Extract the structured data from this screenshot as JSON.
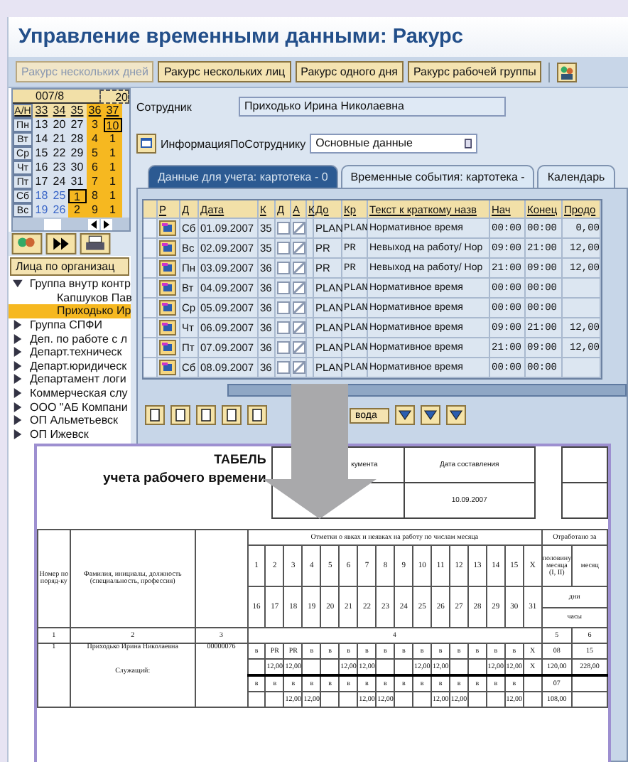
{
  "window": {
    "title": "Управление временными данными: Ракурс"
  },
  "toolbar": [
    {
      "label": "Ракурс нескольких дней",
      "disabled": true
    },
    {
      "label": "Ракурс нескольких лиц",
      "disabled": false
    },
    {
      "label": "Ракурс одного дня",
      "disabled": false
    },
    {
      "label": "Ракурс рабочей группы",
      "disabled": false
    }
  ],
  "calendar": {
    "header": [
      "007/8",
      "20"
    ],
    "weeks": [
      "А/Н",
      "33",
      "34",
      "35",
      "36",
      "37"
    ],
    "rows": [
      {
        "day": "Пн",
        "weekend": false,
        "cells": [
          {
            "text": "13",
            "highlight": false,
            "selected": false
          },
          {
            "text": "20",
            "highlight": false,
            "selected": false
          },
          {
            "text": "27",
            "highlight": false,
            "selected": false
          },
          {
            "text": "3",
            "highlight": true,
            "selected": false
          },
          {
            "text": "10",
            "highlight": true,
            "selected": true
          }
        ]
      },
      {
        "day": "Вт",
        "weekend": false,
        "cells": [
          {
            "text": "14",
            "highlight": false,
            "selected": false
          },
          {
            "text": "21",
            "highlight": false,
            "selected": false
          },
          {
            "text": "28",
            "highlight": false,
            "selected": false
          },
          {
            "text": "4",
            "highlight": true,
            "selected": false
          },
          {
            "text": "1",
            "highlight": true,
            "selected": false
          }
        ]
      },
      {
        "day": "Ср",
        "weekend": false,
        "cells": [
          {
            "text": "15",
            "highlight": false,
            "selected": false
          },
          {
            "text": "22",
            "highlight": false,
            "selected": false
          },
          {
            "text": "29",
            "highlight": false,
            "selected": false
          },
          {
            "text": "5",
            "highlight": true,
            "selected": false
          },
          {
            "text": "1",
            "highlight": true,
            "selected": false
          }
        ]
      },
      {
        "day": "Чт",
        "weekend": false,
        "cells": [
          {
            "text": "16",
            "highlight": false,
            "selected": false
          },
          {
            "text": "23",
            "highlight": false,
            "selected": false
          },
          {
            "text": "30",
            "highlight": false,
            "selected": false
          },
          {
            "text": "6",
            "highlight": true,
            "selected": false
          },
          {
            "text": "1",
            "highlight": true,
            "selected": false
          }
        ]
      },
      {
        "day": "Пт",
        "weekend": false,
        "cells": [
          {
            "text": "17",
            "highlight": false,
            "selected": false
          },
          {
            "text": "24",
            "highlight": false,
            "selected": false
          },
          {
            "text": "31",
            "highlight": false,
            "selected": false
          },
          {
            "text": "7",
            "highlight": true,
            "selected": false
          },
          {
            "text": "1",
            "highlight": true,
            "selected": false
          }
        ]
      },
      {
        "day": "Сб",
        "weekend": true,
        "cells": [
          {
            "text": "18",
            "highlight": false,
            "selected": false
          },
          {
            "text": "25",
            "highlight": false,
            "selected": false
          },
          {
            "text": "1",
            "highlight": true,
            "selected": true
          },
          {
            "text": "8",
            "highlight": true,
            "selected": false
          },
          {
            "text": "1",
            "highlight": true,
            "selected": false
          }
        ]
      },
      {
        "day": "Вс",
        "weekend": true,
        "cells": [
          {
            "text": "19",
            "highlight": false,
            "selected": false
          },
          {
            "text": "26",
            "highlight": false,
            "selected": false
          },
          {
            "text": "2",
            "highlight": true,
            "selected": false
          },
          {
            "text": "9",
            "highlight": true,
            "selected": false
          },
          {
            "text": "1",
            "highlight": true,
            "selected": false
          }
        ]
      }
    ]
  },
  "tree": {
    "header": "Лица по организац",
    "items": [
      {
        "label": "Группа внутр контр",
        "expanded": true,
        "children": [
          {
            "label": "Капшуков Пав",
            "selected": false
          },
          {
            "label": "Приходько Ир",
            "selected": true
          }
        ]
      },
      {
        "label": "Группа СПФИ",
        "expanded": false
      },
      {
        "label": "Деп. по работе с л",
        "expanded": false
      },
      {
        "label": "Департ.техническ",
        "expanded": false
      },
      {
        "label": "Департ.юридическ",
        "expanded": false
      },
      {
        "label": "Департамент логи",
        "expanded": false
      },
      {
        "label": "Коммерческая слу",
        "expanded": false
      },
      {
        "label": "ООО \"АБ Компани",
        "expanded": false
      },
      {
        "label": "ОП Альметьевск",
        "expanded": false
      },
      {
        "label": "ОП Ижевск",
        "expanded": false
      }
    ]
  },
  "employee": {
    "label": "Сотрудник",
    "value": "Приходько Ирина Николаевна"
  },
  "info": {
    "label": "ИнформацияПоСотруднику",
    "value": "Основные данные"
  },
  "tabs": [
    {
      "label": "Данные для учета: картотека - 0",
      "selected": true
    },
    {
      "label": "Временные события: картотека -",
      "selected": false
    },
    {
      "label": "Календарь",
      "selected": false
    }
  ],
  "table": {
    "columns": [
      "Р",
      "Д",
      "Дата",
      "К",
      "Д",
      "А",
      "К",
      "До",
      "Кр",
      "Текст к краткому назв",
      "Нач",
      "Конец",
      "Продо"
    ],
    "rows": [
      {
        "day": "Сб",
        "date": "01.09.2007",
        "k": "35",
        "d_checked": false,
        "a_checked": true,
        "do": "PLAN",
        "kr": "PLAN",
        "text": "Нормативное время",
        "start": "00:00",
        "end": "00:00",
        "dur": "0,00"
      },
      {
        "day": "Вс",
        "date": "02.09.2007",
        "k": "35",
        "d_checked": false,
        "a_checked": true,
        "do": "PR",
        "kr": "PR",
        "text": "Невыход на работу/ Нор",
        "start": "09:00",
        "end": "21:00",
        "dur": "12,00"
      },
      {
        "day": "Пн",
        "date": "03.09.2007",
        "k": "36",
        "d_checked": false,
        "a_checked": true,
        "do": "PR",
        "kr": "PR",
        "text": "Невыход на работу/ Нор",
        "start": "21:00",
        "end": "09:00",
        "dur": "12,00"
      },
      {
        "day": "Вт",
        "date": "04.09.2007",
        "k": "36",
        "d_checked": false,
        "a_checked": true,
        "do": "PLAN",
        "kr": "PLAN",
        "text": "Нормативное время",
        "start": "00:00",
        "end": "00:00"
      },
      {
        "day": "Ср",
        "date": "05.09.2007",
        "k": "36",
        "d_checked": false,
        "a_checked": true,
        "do": "PLAN",
        "kr": "PLAN",
        "text": "Нормативное время",
        "start": "00:00",
        "end": "00:00"
      },
      {
        "day": "Чт",
        "date": "06.09.2007",
        "k": "36",
        "d_checked": false,
        "a_checked": true,
        "do": "PLAN",
        "kr": "PLAN",
        "text": "Нормативное время",
        "start": "09:00",
        "end": "21:00",
        "dur": "12,00"
      },
      {
        "day": "Пт",
        "date": "07.09.2007",
        "k": "36",
        "d_checked": false,
        "a_checked": true,
        "do": "PLAN",
        "kr": "PLAN",
        "text": "Нормативное время",
        "start": "21:00",
        "end": "09:00",
        "dur": "12,00"
      },
      {
        "day": "Сб",
        "date": "08.09.2007",
        "k": "36",
        "d_checked": false,
        "a_checked": true,
        "do": "PLAN",
        "kr": "PLAN",
        "text": "Нормативное время",
        "start": "00:00",
        "end": "00:00"
      }
    ]
  },
  "bottom_button": "вода",
  "document": {
    "title": "ТАБЕЛЬ",
    "subtitle": "учета рабочего времени",
    "doc_number_label": "кумента",
    "date_label": "Дата составления",
    "date": "10.09.2007",
    "col_number": "Номер по поряд-ку",
    "col_name": "Фамилия, инициалы, должность (специальность, профессия)",
    "col_marks": "Отметки о явках и неявках на работу по числам месяца",
    "col_worked": "Отработано за",
    "days_first": [
      "1",
      "2",
      "3",
      "4",
      "5",
      "6",
      "7",
      "8",
      "9",
      "10",
      "11",
      "12",
      "13",
      "14",
      "15",
      "X"
    ],
    "days_second": [
      "16",
      "17",
      "18",
      "19",
      "20",
      "21",
      "22",
      "23",
      "24",
      "25",
      "26",
      "27",
      "28",
      "29",
      "30",
      "31"
    ],
    "col_half": "половину месяца (I, II)",
    "col_month": "месяц",
    "unit_days": "дни",
    "unit_hours": "часы",
    "col_numbers": [
      "1",
      "2",
      "3",
      "4",
      "5",
      "6"
    ],
    "employee": {
      "number": "1",
      "name": "Приходько Ирина Николаевна",
      "position": "Служащий:",
      "tab_number": "00000076",
      "lines": [
        {
          "cells": [
            "в",
            "PR",
            "PR",
            "в",
            "в",
            "в",
            "в",
            "в",
            "в",
            "в",
            "в",
            "в",
            "в",
            "в",
            "в",
            "X"
          ],
          "half": "08",
          "month": "15"
        },
        {
          "cells": [
            null,
            "12,00",
            "12,00",
            null,
            null,
            "12,00",
            "12,00",
            null,
            null,
            "12,00",
            "12,00",
            null,
            null,
            "12,00",
            "12,00",
            "X"
          ],
          "half": "120,00",
          "month": "228,00"
        },
        {
          "cells": [
            "в",
            "в",
            "в",
            "в",
            "в",
            "в",
            "в",
            "в",
            "в",
            "в",
            "в",
            "в",
            "в",
            "в",
            "в",
            null
          ],
          "half": "07"
        },
        {
          "cells": [
            null,
            null,
            "12,00",
            "12,00",
            null,
            null,
            "12,00",
            "12,00",
            null,
            null,
            "12,00",
            "12,00",
            null,
            null,
            "12,00",
            null
          ],
          "half": "108,00"
        }
      ]
    }
  }
}
